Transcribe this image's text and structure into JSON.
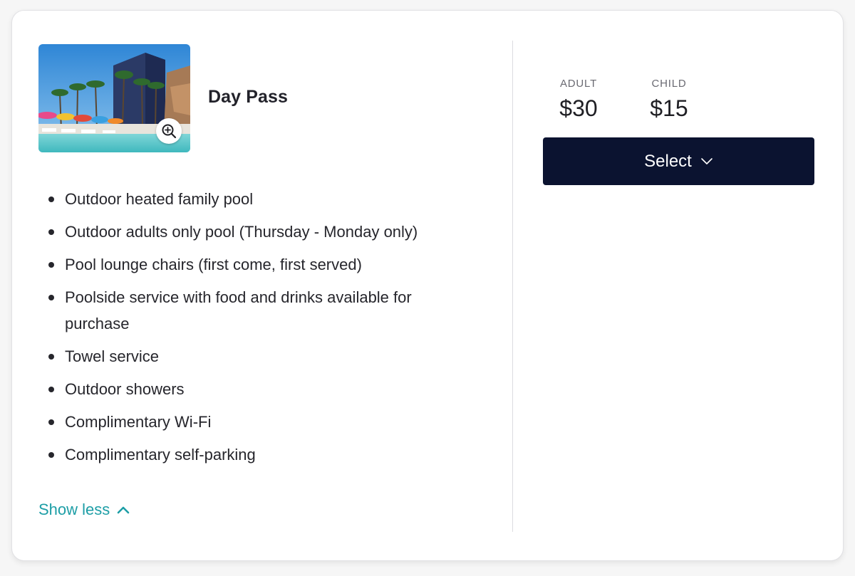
{
  "pass": {
    "title": "Day Pass",
    "image_alt": "pool-photo",
    "zoom_icon": "zoom-in-icon"
  },
  "features": [
    "Outdoor heated family pool",
    "Outdoor adults only pool (Thursday - Monday only)",
    "Pool lounge chairs (first come, first served)",
    "Poolside service with food and drinks available for purchase",
    "Towel service",
    "Outdoor showers",
    "Complimentary Wi-Fi",
    "Complimentary self-parking"
  ],
  "toggle": {
    "label": "Show less",
    "icon": "chevron-up-icon"
  },
  "pricing": {
    "adult": {
      "label": "ADULT",
      "price": "$30"
    },
    "child": {
      "label": "CHILD",
      "price": "$15"
    }
  },
  "select_button": {
    "label": "Select",
    "icon": "chevron-down-icon"
  },
  "colors": {
    "accent_teal": "#1d9ea6",
    "button_navy": "#0b1330",
    "text_dark": "#1f1f24"
  }
}
